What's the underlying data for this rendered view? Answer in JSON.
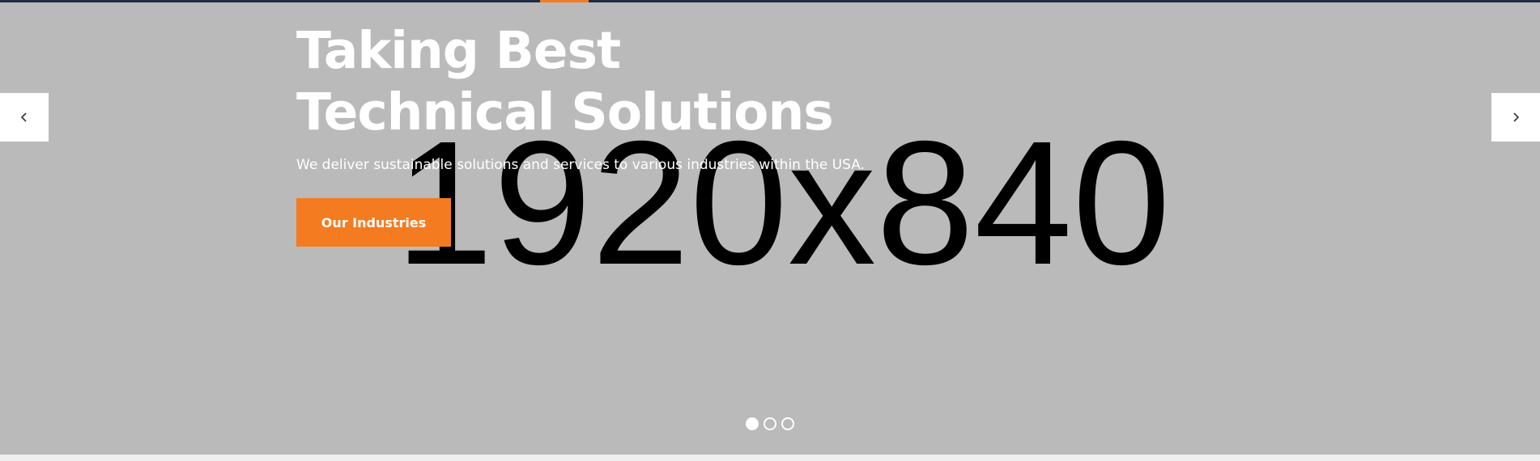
{
  "hero": {
    "placeholder": "1920x840",
    "title_line1": "Taking Best",
    "title_line2": "Technical Solutions",
    "subtitle": "We deliver sustainable solutions and services to various industries within the USA.",
    "cta_label": "Our Industries"
  },
  "slider": {
    "prev_icon": "chevron-left-icon",
    "next_icon": "chevron-right-icon",
    "dots": 3,
    "active_dot": 0
  },
  "colors": {
    "accent": "#f47b20",
    "hero_bg": "#bababa",
    "top_strip": "#1f2a44"
  }
}
